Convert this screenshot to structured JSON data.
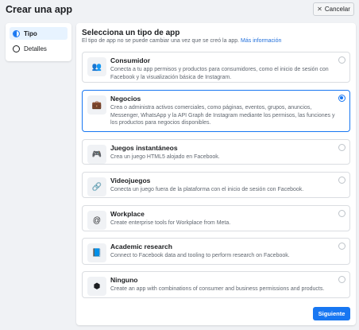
{
  "header": {
    "title": "Crear una app",
    "cancel_label": "Cancelar",
    "cancel_icon": "x-icon"
  },
  "sidebar": {
    "items": [
      {
        "label": "Tipo",
        "icon": "half-circle-icon",
        "active": true
      },
      {
        "label": "Detalles",
        "icon": "empty-circle-icon",
        "active": false
      }
    ]
  },
  "main": {
    "title": "Selecciona un tipo de app",
    "subtitle": "El tipo de app no se puede cambiar una vez que se creó la app.",
    "more_link": "Más información",
    "options": [
      {
        "title": "Consumidor",
        "icon": "users-icon",
        "glyph": "👥",
        "selected": false,
        "description": "Conecta a tu app permisos y productos para consumidores, como el inicio de sesión con Facebook y la visualización básica de Instagram."
      },
      {
        "title": "Negocios",
        "icon": "briefcase-icon",
        "glyph": "💼",
        "selected": true,
        "description": "Crea o administra activos comerciales, como páginas, eventos, grupos, anuncios, Messenger, WhatsApp y la API Graph de Instagram mediante los permisos, las funciones y los productos para negocios disponibles."
      },
      {
        "title": "Juegos instantáneos",
        "icon": "gamepad-icon",
        "glyph": "🎮",
        "selected": false,
        "description": "Crea un juego HTML5 alojado en Facebook."
      },
      {
        "title": "Videojuegos",
        "icon": "link-icon",
        "glyph": "🔗",
        "selected": false,
        "description": "Conecta un juego fuera de la plataforma con el inicio de sesión con Facebook."
      },
      {
        "title": "Workplace",
        "icon": "workplace-icon",
        "glyph": "@",
        "selected": false,
        "description": "Create enterprise tools for Workplace from Meta."
      },
      {
        "title": "Academic research",
        "icon": "book-icon",
        "glyph": "📘",
        "selected": false,
        "description": "Connect to Facebook data and tooling to perform research on Facebook."
      },
      {
        "title": "Ninguno",
        "icon": "cube-icon",
        "glyph": "⬢",
        "selected": false,
        "description": "Create an app with combinations of consumer and business permissions and products."
      }
    ],
    "next_label": "Siguiente"
  },
  "colors": {
    "accent": "#1877f2",
    "link": "#216fdb",
    "background": "#f0f2f5"
  }
}
